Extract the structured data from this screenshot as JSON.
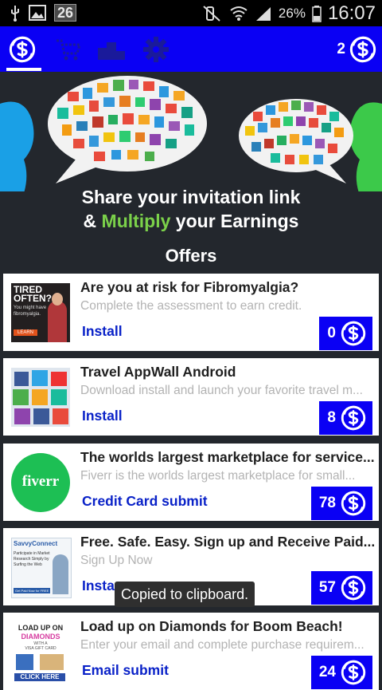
{
  "status_bar": {
    "notification_count": "26",
    "battery_percent": "26%",
    "time": "16:07",
    "icons": [
      "usb-icon",
      "image-icon",
      "mute-icon",
      "wifi-icon",
      "signal-icon",
      "battery-icon"
    ]
  },
  "toolbar": {
    "tabs": [
      "coins-tab",
      "cart-tab",
      "leaderboard-tab",
      "settings-tab"
    ],
    "active_tab": "coins-tab",
    "coin_balance": "2"
  },
  "hero": {
    "line1": "Share your invitation link",
    "line2_prefix": "& ",
    "line2_highlight": "Multiply",
    "line2_suffix": " your Earnings",
    "highlight_color": "#7bd14a"
  },
  "offers_title": "Offers",
  "offers": [
    {
      "title": "Are you at risk for Fibromyalgia?",
      "description": "Complete the assessment to earn credit.",
      "action": "Install",
      "reward": "0",
      "thumb": {
        "line1": "TIRED",
        "line2": "OFTEN?",
        "line3": "You might have",
        "line4": "fibromyalgia.",
        "button": "LEARN"
      }
    },
    {
      "title": "Travel AppWall Android",
      "description": "Download install and launch your favorite travel m...",
      "action": "Install",
      "reward": "8"
    },
    {
      "title": "The worlds largest marketplace for service...",
      "description": "Fiverr is the worlds largest marketplace for small...",
      "action": "Credit Card submit",
      "reward": "78",
      "thumb": {
        "logo": "fiverr"
      }
    },
    {
      "title": "Free. Safe. Easy. Sign up and Receive Paid...",
      "description": "Sign Up Now",
      "action": "Insta",
      "reward": "57",
      "thumb": {
        "brand": "SavvyConnect",
        "line1": "Participate in Market",
        "line2": "Research Simply by",
        "line3": "Surfing the Web",
        "button": "Get Paid Now for FREE"
      }
    },
    {
      "title": "Load up on Diamonds for Boom Beach!",
      "description": "Enter your email and complete purchase requirem...",
      "action": "Email submit",
      "reward": "24",
      "thumb": {
        "line1": "LOAD UP ON",
        "line2": "DIAMONDS",
        "line3": "WITH A",
        "line4": "VISA GIFT CARD",
        "button": "CLICK HERE"
      }
    }
  ],
  "toast": "Copied to clipboard.",
  "colors": {
    "toolbar": "#0a00f4",
    "background": "#23272d",
    "action_text": "#0a22c8"
  }
}
